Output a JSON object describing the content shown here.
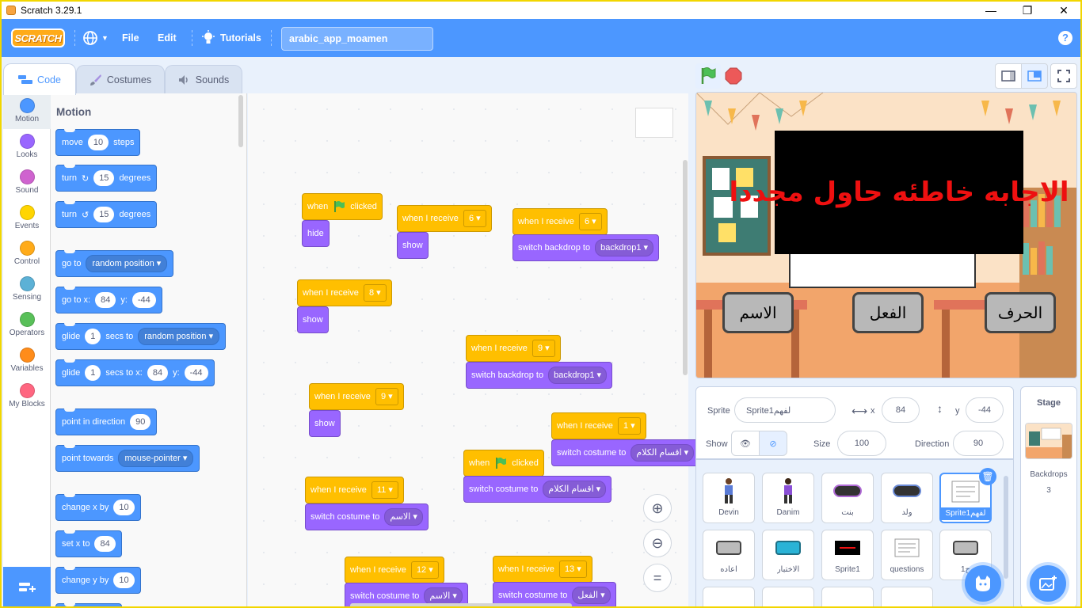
{
  "window": {
    "title": "Scratch 3.29.1",
    "minimize": "—",
    "restore": "❐",
    "close": "✕"
  },
  "menu": {
    "logo": "SCRATCH",
    "file": "File",
    "edit": "Edit",
    "tutorials": "Tutorials",
    "project_name": "arabic_app_moamen",
    "help": "?"
  },
  "tabs": {
    "code": "Code",
    "costumes": "Costumes",
    "sounds": "Sounds"
  },
  "categories": [
    {
      "label": "Motion",
      "color": "#4c97ff"
    },
    {
      "label": "Looks",
      "color": "#9966ff"
    },
    {
      "label": "Sound",
      "color": "#cf63cf"
    },
    {
      "label": "Events",
      "color": "#ffd500"
    },
    {
      "label": "Control",
      "color": "#ffab19"
    },
    {
      "label": "Sensing",
      "color": "#5cb1d6"
    },
    {
      "label": "Operators",
      "color": "#59c059"
    },
    {
      "label": "Variables",
      "color": "#ff8c1a"
    },
    {
      "label": "My Blocks",
      "color": "#ff6680"
    }
  ],
  "palette": {
    "title": "Motion",
    "move": {
      "a": "move",
      "v": "10",
      "b": "steps"
    },
    "turn_cw": {
      "a": "turn",
      "v": "15",
      "b": "degrees"
    },
    "turn_ccw": {
      "a": "turn",
      "v": "15",
      "b": "degrees"
    },
    "goto": {
      "a": "go to",
      "dd": "random position"
    },
    "gotoxy": {
      "a": "go to x:",
      "x": "84",
      "ylab": "y:",
      "y": "-44"
    },
    "glide1": {
      "a": "glide",
      "v": "1",
      "b": "secs to",
      "dd": "random position"
    },
    "glide2": {
      "a": "glide",
      "v": "1",
      "b": "secs to x:",
      "x": "84",
      "ylab": "y:",
      "y": "-44"
    },
    "point_dir": {
      "a": "point in direction",
      "v": "90"
    },
    "point_towards": {
      "a": "point towards",
      "dd": "mouse-pointer"
    },
    "changex": {
      "a": "change x by",
      "v": "10"
    },
    "setx": {
      "a": "set x to",
      "v": "84"
    },
    "changey": {
      "a": "change y by",
      "v": "10"
    }
  },
  "scripts": {
    "flag1": {
      "when": "when",
      "clicked": "clicked",
      "body": "hide"
    },
    "recv6a": {
      "hat": "when I receive",
      "msg": "6",
      "body": "show"
    },
    "recv6b": {
      "hat": "when I receive",
      "msg": "6",
      "body": "switch backdrop to",
      "dd": "backdrop1"
    },
    "recv8": {
      "hat": "when I receive",
      "msg": "8",
      "body": "show"
    },
    "recv9a": {
      "hat": "when I receive",
      "msg": "9",
      "body": "switch backdrop to",
      "dd": "backdrop1"
    },
    "recv9b": {
      "hat": "when I receive",
      "msg": "9",
      "body": "show"
    },
    "recv1": {
      "hat": "when I receive",
      "msg": "1",
      "body": "switch costume to",
      "dd": "اقسام الكلام"
    },
    "flag2": {
      "when": "when",
      "clicked": "clicked",
      "body": "switch costume to",
      "dd": "اقسام الكلام"
    },
    "recv11": {
      "hat": "when I receive",
      "msg": "11",
      "body": "switch costume to",
      "dd": "الاسم"
    },
    "recv12": {
      "hat": "when I receive",
      "msg": "12",
      "body": "switch costume to",
      "dd": "الاسم"
    },
    "recv13": {
      "hat": "when I receive",
      "msg": "13",
      "body": "switch costume to",
      "dd": "الفعل"
    }
  },
  "stage_view": {
    "message": "الاجابه خاطئه حاول مجددا",
    "btn_right": "الحرف",
    "btn_mid": "الفعل",
    "btn_left": "الاسم"
  },
  "sprite_info": {
    "sprite_label": "Sprite",
    "sprite_name": "Sprite1لفهم",
    "x_label": "x",
    "x": "84",
    "y_label": "y",
    "y": "-44",
    "show_label": "Show",
    "size_label": "Size",
    "size": "100",
    "direction_label": "Direction",
    "direction": "90"
  },
  "sprites": [
    {
      "name": "Devin"
    },
    {
      "name": "Danim"
    },
    {
      "name": "بنت"
    },
    {
      "name": "ولد"
    },
    {
      "name": "Sprite1لفهم"
    },
    {
      "name": "اعاده"
    },
    {
      "name": "الاختبار"
    },
    {
      "name": "Sprite1"
    },
    {
      "name": "questions"
    },
    {
      "name": "1ح"
    }
  ],
  "stage_panel": {
    "title": "Stage",
    "backdrops_label": "Backdrops",
    "backdrops_count": "3"
  },
  "colors": {
    "motion": "#4c97ff",
    "events": "#ffbf00",
    "looks": "#9966ff",
    "menubar": "#4c97ff",
    "stop": "#ec5959",
    "flag": "#4cbf56"
  }
}
